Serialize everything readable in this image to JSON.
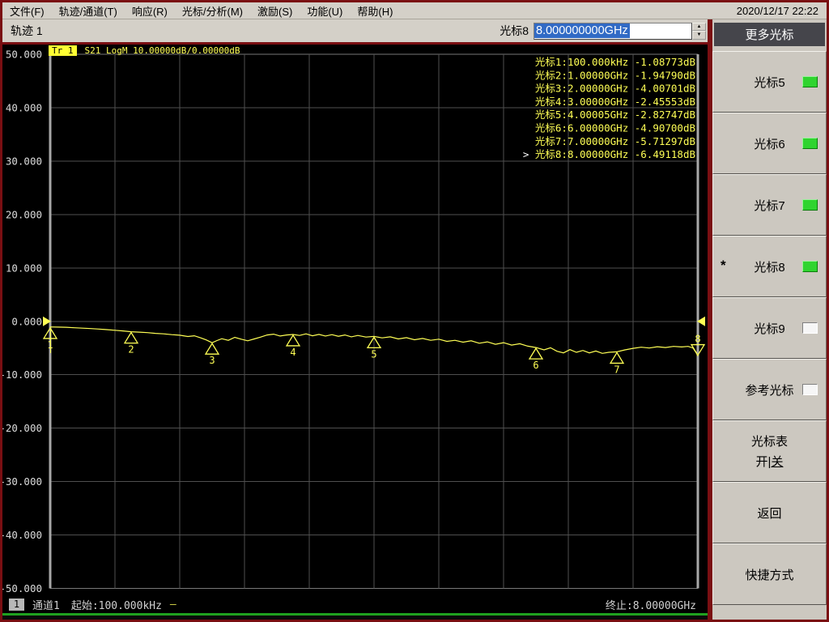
{
  "window": {
    "datetime": "2020/12/17 22:22"
  },
  "menu": {
    "items": [
      {
        "label": "文件(F)"
      },
      {
        "label": "轨迹/通道(T)"
      },
      {
        "label": "响应(R)"
      },
      {
        "label": "光标/分析(M)"
      },
      {
        "label": "激励(S)"
      },
      {
        "label": "功能(U)"
      },
      {
        "label": "帮助(H)"
      }
    ]
  },
  "toolbar": {
    "trace_label": "轨迹 1",
    "marker_label": "光标8",
    "marker_value": "8.000000000GHz"
  },
  "sidebar": {
    "header": "更多光标",
    "buttons": [
      {
        "label": "光标5",
        "led": "on"
      },
      {
        "label": "光标6",
        "led": "on"
      },
      {
        "label": "光标7",
        "led": "on"
      },
      {
        "label": "光标8",
        "led": "on",
        "active_marker": "*"
      },
      {
        "label": "光标9",
        "led": "off"
      },
      {
        "label": "参考光标",
        "led": "off"
      },
      {
        "label": "光标表",
        "toggle_on": "开",
        "toggle_sep": "|",
        "toggle_off": "关"
      },
      {
        "label": "返回"
      },
      {
        "label": "快捷方式"
      }
    ]
  },
  "status_bar": {
    "channel_badge": "1",
    "channel": "通道1",
    "start": "起始:100.000kHz",
    "dash": "—",
    "stop": "终止:8.00000GHz"
  },
  "chart_data": {
    "type": "line",
    "title": "Tr 1",
    "trace_info": "S21 LogM 10.00000dB/0.00000dB",
    "ylabel": "dB",
    "ylim": [
      -50,
      50
    ],
    "ytick_step": 10,
    "yticks": [
      "50.000",
      "40.000",
      "30.000",
      "20.000",
      "10.000",
      "0.000",
      "-10.000",
      "-20.000",
      "-30.000",
      "-40.000",
      "-50.000"
    ],
    "x_start_label": "100.000kHz",
    "x_stop_label": "8.00000GHz",
    "xlim_ghz": [
      0,
      8
    ],
    "x_divisions": 10,
    "ref_level_db": 0,
    "grid": true,
    "legend_position": "top-right",
    "readout_prefix": "光标",
    "markers": [
      {
        "n": "1",
        "ghz": 0.0001,
        "db": -1.08773,
        "freq_label": "100.000kHz",
        "value_label": "-1.08773dB",
        "active": false
      },
      {
        "n": "2",
        "ghz": 1.0,
        "db": -1.9479,
        "freq_label": "1.00000GHz",
        "value_label": "-1.94790dB",
        "active": false
      },
      {
        "n": "3",
        "ghz": 2.0,
        "db": -4.00701,
        "freq_label": "2.00000GHz",
        "value_label": "-4.00701dB",
        "active": false
      },
      {
        "n": "4",
        "ghz": 3.0,
        "db": -2.45553,
        "freq_label": "3.00000GHz",
        "value_label": "-2.45553dB",
        "active": false
      },
      {
        "n": "5",
        "ghz": 4.00005,
        "db": -2.82747,
        "freq_label": "4.00005GHz",
        "value_label": "-2.82747dB",
        "active": false
      },
      {
        "n": "6",
        "ghz": 6.0,
        "db": -4.907,
        "freq_label": "6.00000GHz",
        "value_label": "-4.90700dB",
        "active": false
      },
      {
        "n": "7",
        "ghz": 7.0,
        "db": -5.71297,
        "freq_label": "7.00000GHz",
        "value_label": "-5.71297dB",
        "active": false
      },
      {
        "n": "8",
        "ghz": 8.0,
        "db": -6.49118,
        "freq_label": "8.00000GHz",
        "value_label": "-6.49118dB",
        "active": true
      }
    ],
    "trace_points_ghz_db": [
      [
        0.0,
        -1.05
      ],
      [
        0.1,
        -1.08
      ],
      [
        0.2,
        -1.12
      ],
      [
        0.3,
        -1.2
      ],
      [
        0.4,
        -1.28
      ],
      [
        0.5,
        -1.35
      ],
      [
        0.6,
        -1.45
      ],
      [
        0.7,
        -1.55
      ],
      [
        0.8,
        -1.68
      ],
      [
        0.9,
        -1.8
      ],
      [
        1.0,
        -1.95
      ],
      [
        1.1,
        -2.02
      ],
      [
        1.2,
        -2.12
      ],
      [
        1.3,
        -2.25
      ],
      [
        1.4,
        -2.35
      ],
      [
        1.5,
        -2.5
      ],
      [
        1.6,
        -2.6
      ],
      [
        1.7,
        -2.85
      ],
      [
        1.78,
        -2.7
      ],
      [
        1.86,
        -3.1
      ],
      [
        1.93,
        -3.5
      ],
      [
        2.0,
        -4.01
      ],
      [
        2.06,
        -3.6
      ],
      [
        2.12,
        -3.25
      ],
      [
        2.2,
        -3.55
      ],
      [
        2.28,
        -3.0
      ],
      [
        2.36,
        -3.35
      ],
      [
        2.44,
        -3.65
      ],
      [
        2.52,
        -3.3
      ],
      [
        2.6,
        -2.95
      ],
      [
        2.68,
        -2.55
      ],
      [
        2.76,
        -2.4
      ],
      [
        2.84,
        -2.75
      ],
      [
        2.92,
        -2.55
      ],
      [
        3.0,
        -2.46
      ],
      [
        3.08,
        -2.65
      ],
      [
        3.16,
        -2.35
      ],
      [
        3.24,
        -2.7
      ],
      [
        3.32,
        -2.45
      ],
      [
        3.4,
        -2.75
      ],
      [
        3.48,
        -2.5
      ],
      [
        3.56,
        -2.8
      ],
      [
        3.64,
        -2.55
      ],
      [
        3.72,
        -2.9
      ],
      [
        3.8,
        -2.65
      ],
      [
        3.9,
        -2.95
      ],
      [
        4.0,
        -2.83
      ],
      [
        4.1,
        -3.1
      ],
      [
        4.2,
        -2.9
      ],
      [
        4.3,
        -3.3
      ],
      [
        4.4,
        -3.05
      ],
      [
        4.5,
        -3.45
      ],
      [
        4.6,
        -3.2
      ],
      [
        4.7,
        -3.55
      ],
      [
        4.8,
        -3.35
      ],
      [
        4.9,
        -3.75
      ],
      [
        5.0,
        -3.55
      ],
      [
        5.1,
        -3.9
      ],
      [
        5.2,
        -3.65
      ],
      [
        5.3,
        -4.1
      ],
      [
        5.4,
        -3.85
      ],
      [
        5.5,
        -4.3
      ],
      [
        5.6,
        -4.0
      ],
      [
        5.7,
        -4.45
      ],
      [
        5.8,
        -4.2
      ],
      [
        5.9,
        -4.65
      ],
      [
        6.0,
        -4.91
      ],
      [
        6.1,
        -5.35
      ],
      [
        6.18,
        -4.95
      ],
      [
        6.26,
        -5.6
      ],
      [
        6.34,
        -5.9
      ],
      [
        6.42,
        -5.3
      ],
      [
        6.5,
        -5.8
      ],
      [
        6.58,
        -5.45
      ],
      [
        6.66,
        -5.9
      ],
      [
        6.74,
        -5.55
      ],
      [
        6.82,
        -6.0
      ],
      [
        6.9,
        -5.8
      ],
      [
        7.0,
        -5.71
      ],
      [
        7.1,
        -5.35
      ],
      [
        7.2,
        -5.05
      ],
      [
        7.3,
        -4.85
      ],
      [
        7.4,
        -5.0
      ],
      [
        7.5,
        -4.75
      ],
      [
        7.6,
        -4.9
      ],
      [
        7.7,
        -4.7
      ],
      [
        7.8,
        -4.8
      ],
      [
        7.88,
        -4.7
      ],
      [
        7.94,
        -5.0
      ],
      [
        7.98,
        -5.9
      ],
      [
        8.0,
        -6.49
      ]
    ],
    "colors": {
      "trace": "#ffff55",
      "grid": "#4f4f4f",
      "axis": "#a8a8a8",
      "frame": "#787878",
      "tick_text": "#dcdcdc",
      "readout_text": "#ffff55",
      "active_pointer": "#ffffff"
    }
  }
}
